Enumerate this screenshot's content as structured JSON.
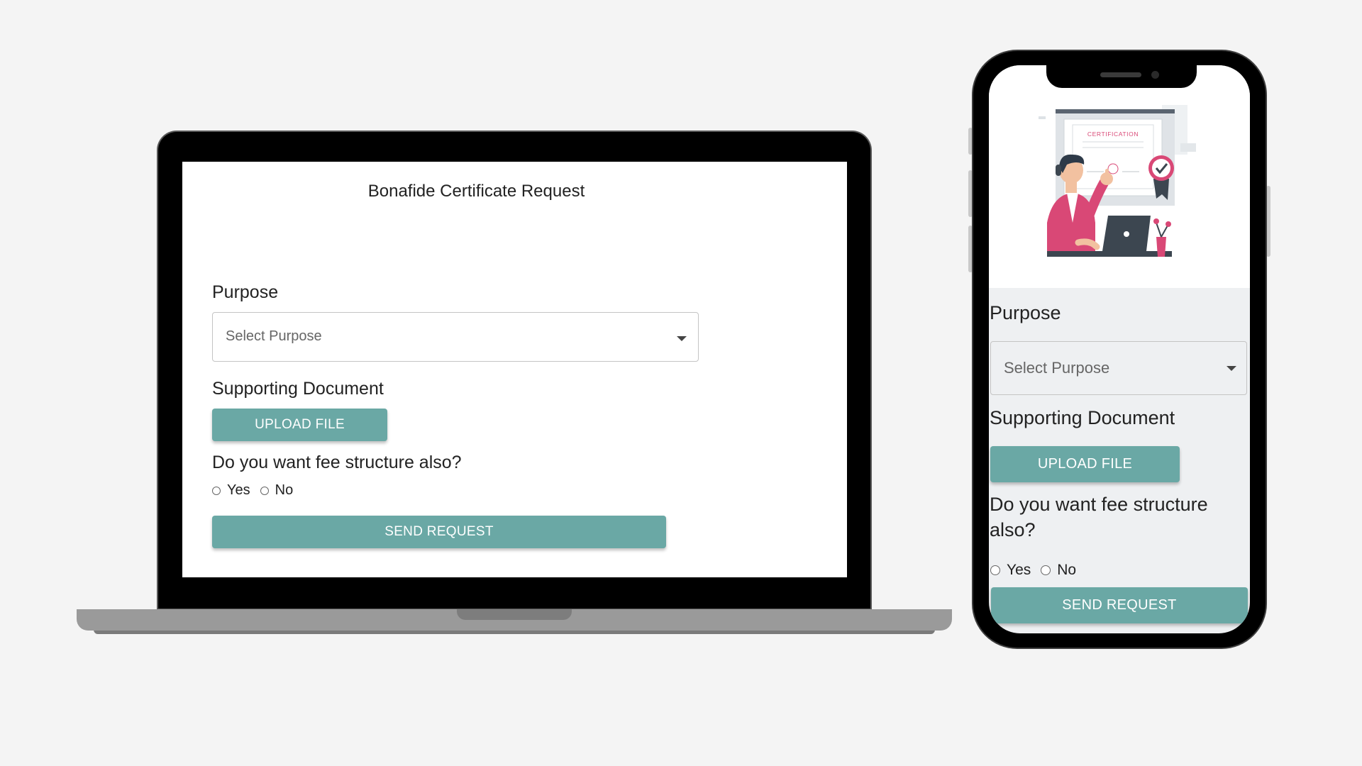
{
  "laptop": {
    "title": "Bonafide Certificate Request",
    "purpose_label": "Purpose",
    "purpose_placeholder": "Select Purpose",
    "document_label": "Supporting Document",
    "upload_label": "UPLOAD FILE",
    "fee_question": "Do you want fee structure also?",
    "option_yes": "Yes",
    "option_no": "No",
    "send_label": "SEND REQUEST"
  },
  "phone": {
    "hero_text": "CERTIFICATION",
    "purpose_label": "Purpose",
    "purpose_placeholder": "Select Purpose",
    "document_label": "Supporting Document",
    "upload_label": "UPLOAD FILE",
    "fee_question": "Do you want fee structure also?",
    "option_yes": "Yes",
    "option_no": "No",
    "send_label": "SEND REQUEST"
  },
  "colors": {
    "accent": "#6aa8a5",
    "background": "#f4f4f4",
    "illustration_pink": "#d94876"
  },
  "icons": {
    "dropdown": "caret-down-icon",
    "illustration": "certification-illustration"
  }
}
